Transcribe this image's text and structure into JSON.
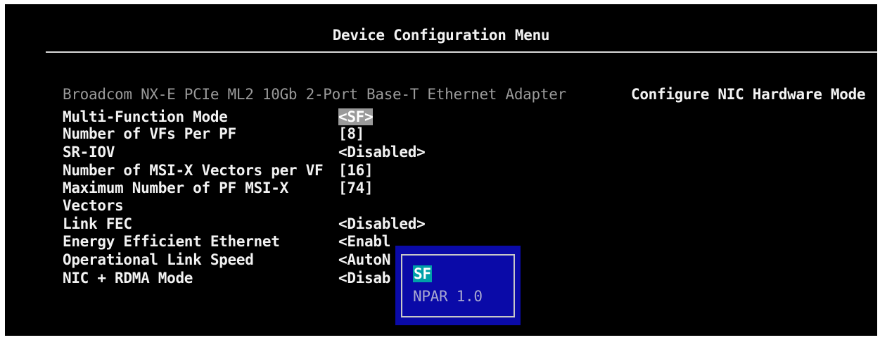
{
  "header": {
    "title": "Device Configuration Menu"
  },
  "help_text": "Configure NIC Hardware Mode",
  "adapter_name": "Broadcom NX-E PCIe ML2 10Gb 2-Port Base-T Ethernet Adapter",
  "settings": [
    {
      "label": "Multi-Function Mode",
      "value": "<SF>"
    },
    {
      "label": "Number of VFs Per PF",
      "value": "[8]"
    },
    {
      "label": "SR-IOV",
      "value": "<Disabled>"
    },
    {
      "label": "Number of MSI-X Vectors per VF",
      "value": "[16]"
    },
    {
      "label": "Maximum Number of PF MSI-X",
      "label_line2": "Vectors",
      "value": "[74]"
    },
    {
      "label": "Link FEC",
      "value": "<Disabled>"
    },
    {
      "label": "Energy Efficient Ethernet",
      "value": "<Enabl"
    },
    {
      "label": "Operational Link Speed",
      "value": "<AutoN"
    },
    {
      "label": "NIC + RDMA Mode",
      "value": "<Disab"
    }
  ],
  "popup": {
    "options": [
      "SF",
      "NPAR 1.0"
    ],
    "selected": "SF"
  },
  "colors": {
    "background": "#000000",
    "text": "#f2f2f2",
    "popup_bg": "#0a0aa8",
    "selection": "#00a0a8",
    "disabled_text": "#9a9a9a"
  }
}
